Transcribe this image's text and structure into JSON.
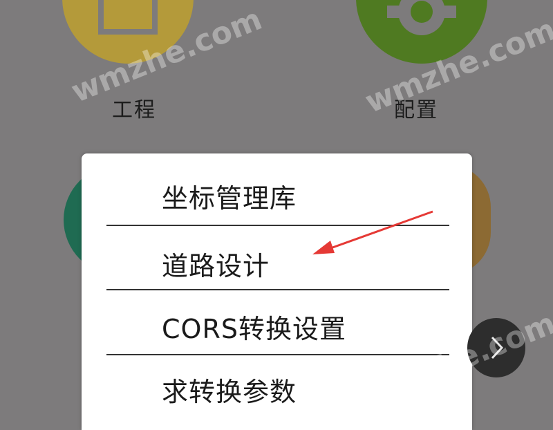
{
  "home_icons": [
    {
      "label": "工程",
      "icon": "project-icon",
      "color": "#b49a3a"
    },
    {
      "label": "配置",
      "icon": "gear-icon",
      "color": "#4f7a21"
    }
  ],
  "popup_menu": {
    "items": [
      {
        "label": "坐标管理库"
      },
      {
        "label": "道路设计"
      },
      {
        "label": "CORS转换设置"
      },
      {
        "label": "求转换参数"
      }
    ]
  },
  "annotation": {
    "color": "#e53935",
    "points_to": "道路设计"
  },
  "navigation": {
    "next_icon": "chevron-right-icon"
  },
  "watermark": {
    "text": "wmzhe.com"
  },
  "colors": {
    "background": "#7d7b7c",
    "menu_background": "#ffffff",
    "next_button": "#2d2d2d"
  }
}
